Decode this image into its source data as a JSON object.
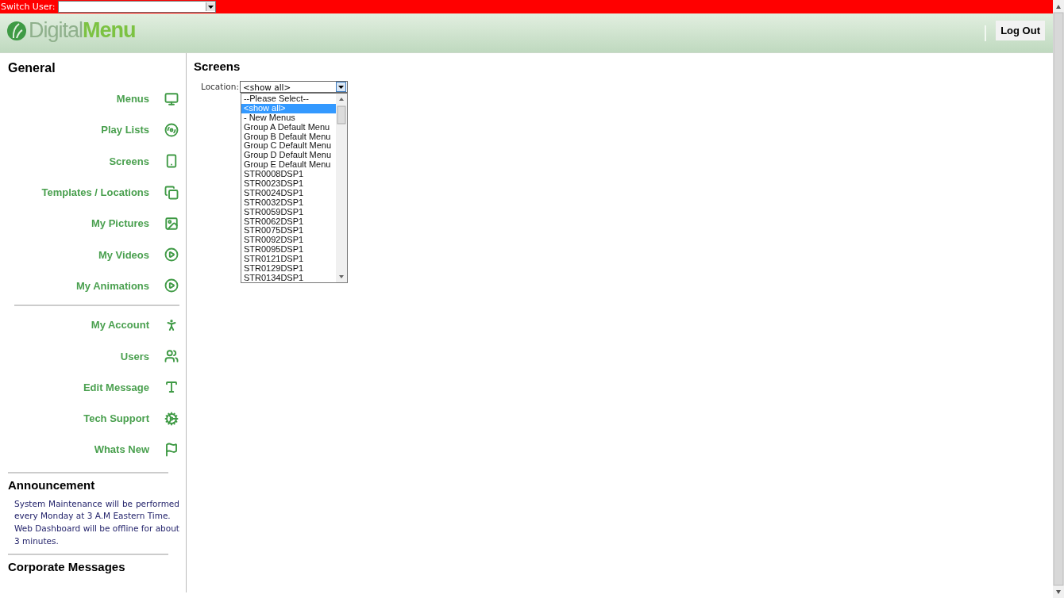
{
  "top_bar": {
    "label": "Switch User:"
  },
  "header": {
    "logo": {
      "first": "Digital",
      "second": "Menu"
    },
    "logout_button": "Log Out"
  },
  "sidebar": {
    "title": "General",
    "groups": [
      [
        {
          "label": "Menus"
        },
        {
          "label": "Play Lists"
        },
        {
          "label": "Screens"
        },
        {
          "label": "Templates / Locations"
        },
        {
          "label": "My Pictures"
        },
        {
          "label": "My Videos"
        },
        {
          "label": "My Animations"
        }
      ],
      [
        {
          "label": "My Account"
        },
        {
          "label": "Users"
        },
        {
          "label": "Edit Message"
        },
        {
          "label": "Tech Support"
        },
        {
          "label": "Whats New"
        }
      ]
    ],
    "announcement": {
      "title": "Announcement",
      "lines": [
        "System Maintenance will be performed every Monday at 3 A.M Eastern Time.",
        "Web Dashboard will be offline for about 3 minutes."
      ]
    },
    "corporate_messages": {
      "title": "Corporate Messages"
    }
  },
  "main": {
    "title": "Screens",
    "location": {
      "label": "Location:",
      "value": "<show all>",
      "expanded": true,
      "options": [
        {
          "label": "--Please Select--",
          "selected": false
        },
        {
          "label": "<show all>",
          "selected": true
        },
        {
          "label": "- New Menus",
          "selected": false
        },
        {
          "label": "Group A Default Menu",
          "selected": false
        },
        {
          "label": "Group B Default Menu",
          "selected": false
        },
        {
          "label": "Group C Default Menu",
          "selected": false
        },
        {
          "label": "Group D Default Menu",
          "selected": false
        },
        {
          "label": "Group E Default Menu",
          "selected": false
        },
        {
          "label": "STR0008DSP1",
          "selected": false
        },
        {
          "label": "STR0023DSP1",
          "selected": false
        },
        {
          "label": "STR0024DSP1",
          "selected": false
        },
        {
          "label": "STR0032DSP1",
          "selected": false
        },
        {
          "label": "STR0059DSP1",
          "selected": false
        },
        {
          "label": "STR0062DSP1",
          "selected": false
        },
        {
          "label": "STR0075DSP1",
          "selected": false
        },
        {
          "label": "STR0092DSP1",
          "selected": false
        },
        {
          "label": "STR0095DSP1",
          "selected": false
        },
        {
          "label": "STR0121DSP1",
          "selected": false
        },
        {
          "label": "STR0129DSP1",
          "selected": false
        },
        {
          "label": "STR0134DSP1",
          "selected": false
        }
      ]
    }
  }
}
